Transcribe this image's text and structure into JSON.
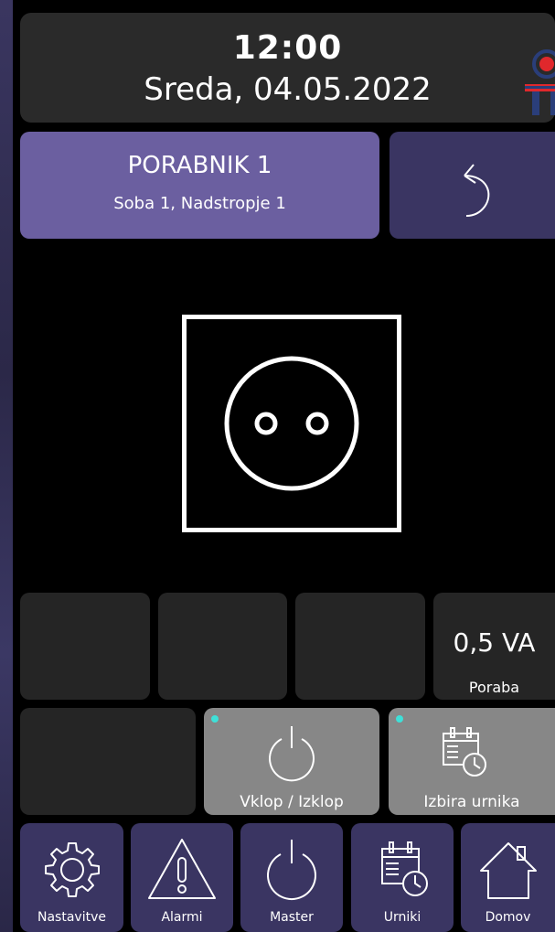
{
  "header": {
    "time": "12:00",
    "date": "Sreda, 04.05.2022"
  },
  "device": {
    "title": "PORABNIK 1",
    "subtitle": "Soba 1, Nadstropje 1"
  },
  "icons": {
    "back": "back-arrow-icon",
    "socket": "power-socket-icon",
    "power": "power-icon",
    "schedule": "calendar-clock-icon",
    "settings": "gear-icon",
    "alarm": "warning-icon",
    "home": "home-icon"
  },
  "consumption": {
    "value": "0,5 VA",
    "label": "Poraba"
  },
  "actions": {
    "toggle_label": "Vklop / Izklop",
    "schedule_label": "Izbira urnika"
  },
  "nav": {
    "settings": "Nastavitve",
    "alarms": "Alarmi",
    "master": "Master",
    "schedules": "Urniki",
    "home": "Domov"
  },
  "colors": {
    "accent_purple": "#6b5fa0",
    "dark_purple": "#3a3562",
    "tile_dark": "#252525",
    "tile_gray": "#878787",
    "status_dot": "#3fe0d8"
  }
}
